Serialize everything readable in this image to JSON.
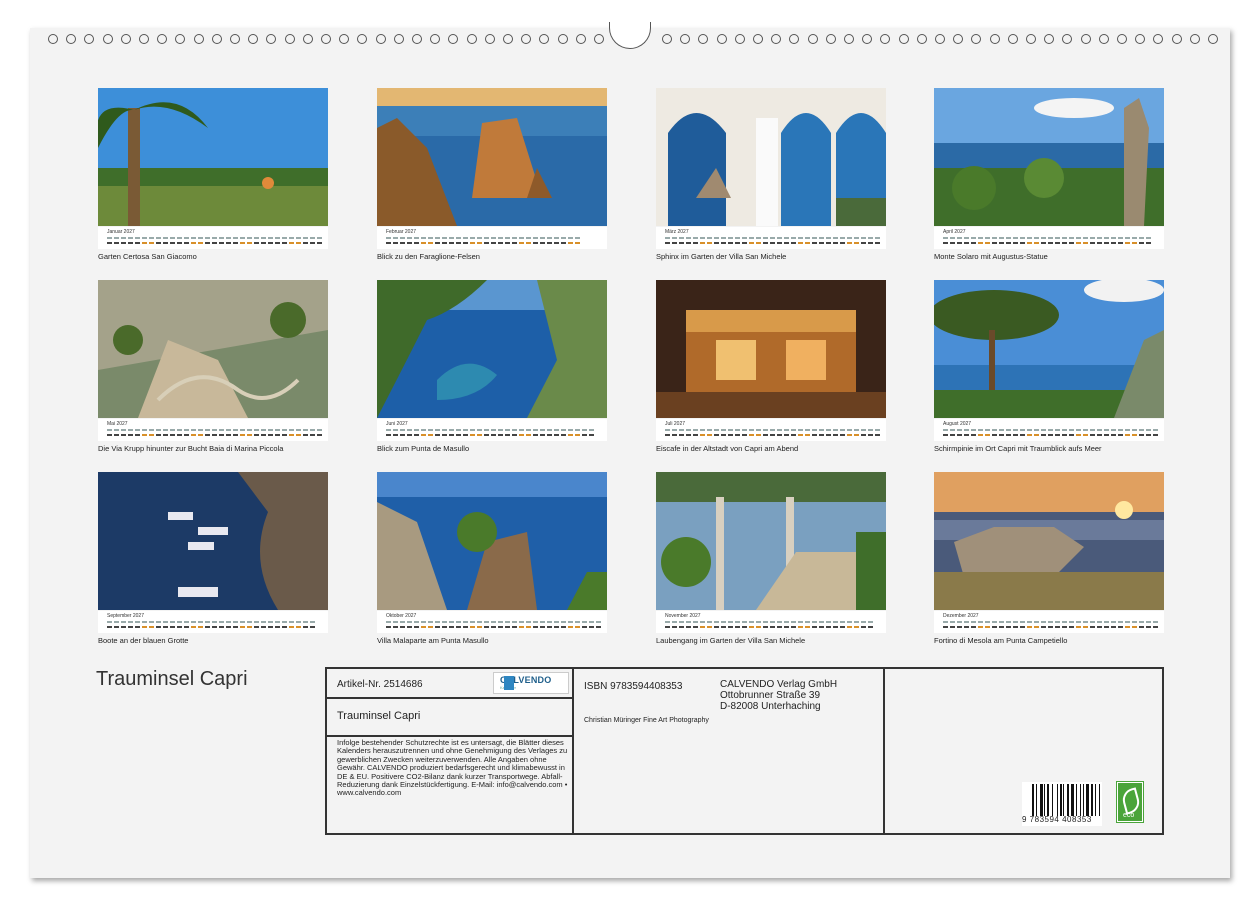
{
  "title": "Trauminsel Capri",
  "months": [
    {
      "name": "Januar 2027",
      "caption": "Garten Certosa San Giacomo",
      "days": 31
    },
    {
      "name": "Februar 2027",
      "caption": "Blick zu den Faraglione-Felsen",
      "days": 28
    },
    {
      "name": "März 2027",
      "caption": "Sphinx im Garten der Villa San Michele",
      "days": 31
    },
    {
      "name": "April 2027",
      "caption": "Monte Solaro mit Augustus-Statue",
      "days": 30
    },
    {
      "name": "Mai 2027",
      "caption": "Die Via Krupp hinunter zur Bucht Baia di Marina Piccola",
      "days": 31
    },
    {
      "name": "Juni 2027",
      "caption": "Blick zum Punta de Masullo",
      "days": 30
    },
    {
      "name": "Juli 2027",
      "caption": "Eiscafe in der Altstadt von Capri am Abend",
      "days": 31
    },
    {
      "name": "August 2027",
      "caption": "Schirmpinie im Ort Capri mit Traumblick aufs Meer",
      "days": 31
    },
    {
      "name": "September 2027",
      "caption": "Boote an der blauen Grotte",
      "days": 30
    },
    {
      "name": "Oktober 2027",
      "caption": "Villa Malaparte am Punta Masullo",
      "days": 31
    },
    {
      "name": "November 2027",
      "caption": "Laubengang im Garten der Villa San Michele",
      "days": 30
    },
    {
      "name": "Dezember 2027",
      "caption": "Fortino di Mesola am Punta Campetiello",
      "days": 31
    }
  ],
  "info": {
    "article": "Artikel-Nr. 2514686",
    "logo_title": "CALVENDO",
    "logo_sub": "Kalender",
    "subtitle": "Trauminsel Capri",
    "legal": "Infolge bestehender Schutzrechte ist es untersagt, die Blätter dieses Kalenders herauszutrennen und ohne Genehmigung des Verlages zu gewerblichen Zwecken weiterzuverwenden. Alle Angaben ohne Gewähr. CALVENDO produziert bedarfsgerecht und klimabewusst in DE & EU. Positivere CO2-Bilanz dank kurzer Transportwege. Abfall-Reduzierung dank Einzelstückfertigung. E-Mail: info@calvendo.com • www.calvendo.com",
    "isbn": "ISBN 9783594408353",
    "publisher_name": "CALVENDO Verlag GmbH",
    "publisher_street": "Ottobrunner Straße 39",
    "publisher_city": "D-82008 Unterhaching",
    "photographer": "Christian Müringer Fine Art Photography",
    "barcode_number": "9 783594 408353",
    "eco_label": "eco"
  },
  "colors": {
    "eco_green": "#4aa43a",
    "weekend": "#d8902a",
    "calvendo_blue": "#1f5f8b"
  }
}
